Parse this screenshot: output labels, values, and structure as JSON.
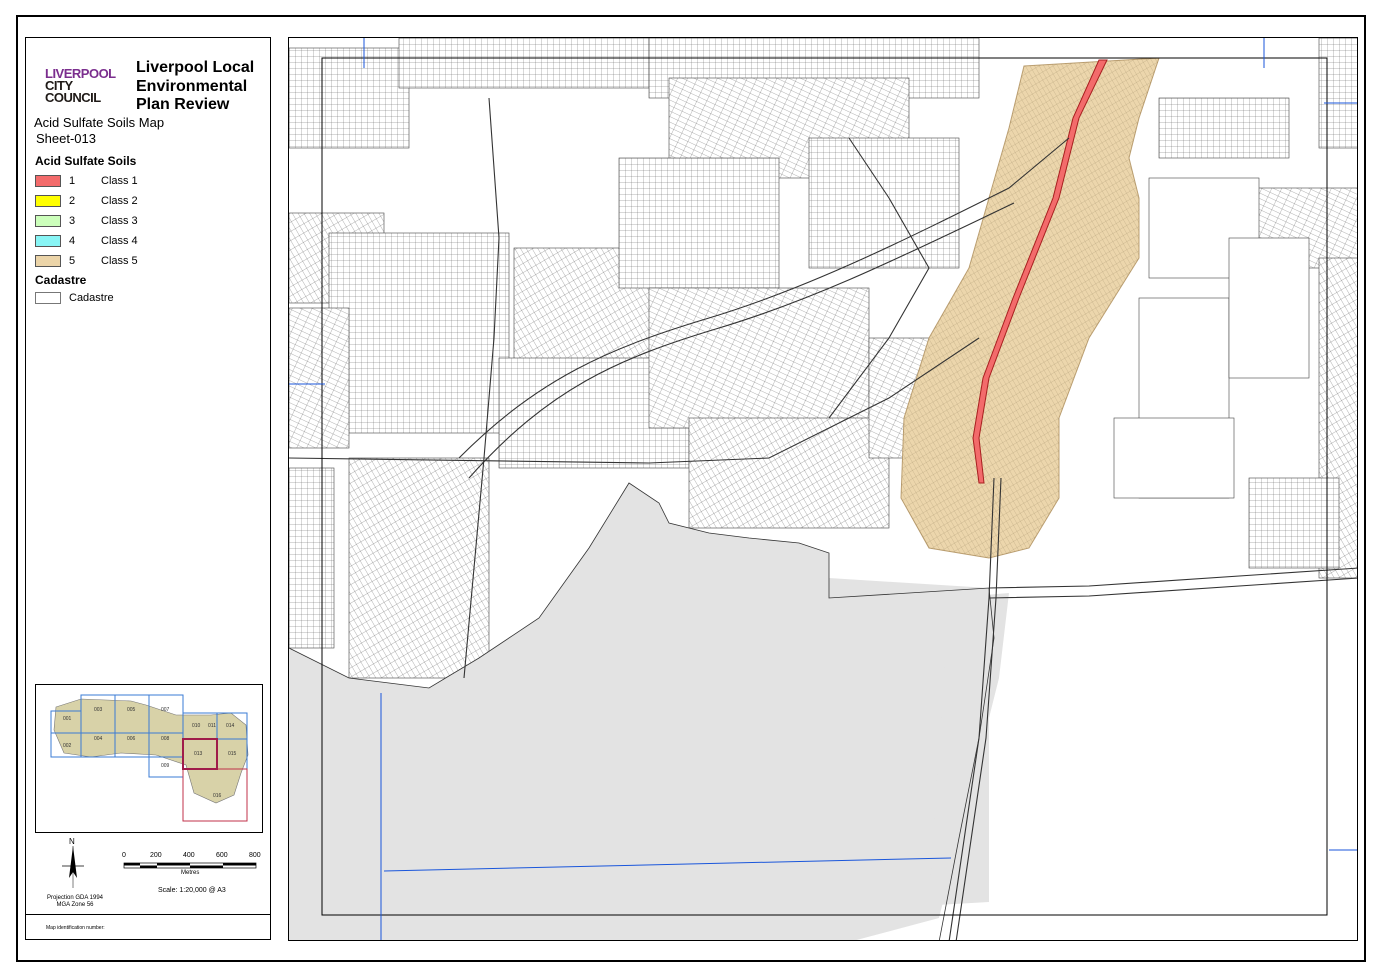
{
  "header": {
    "logo_line1": "LIVERPOOL",
    "logo_line2": "CITY",
    "logo_line3": "COUNCIL",
    "title": "Liverpool Local Environmental Plan Review",
    "subtitle": "Acid Sulfate Soils Map",
    "sheet": "Sheet-013"
  },
  "legend": {
    "heading": "Acid Sulfate Soils",
    "classes": [
      {
        "num": "1",
        "label": "Class 1",
        "color": "#f36b6b"
      },
      {
        "num": "2",
        "label": "Class 2",
        "color": "#ffff00"
      },
      {
        "num": "3",
        "label": "Class 3",
        "color": "#ccffbb"
      },
      {
        "num": "4",
        "label": "Class 4",
        "color": "#88f5f5"
      },
      {
        "num": "5",
        "label": "Class 5",
        "color": "#ebd4a8"
      }
    ],
    "cadastre_heading": "Cadastre",
    "cadastre_label": "Cadastre"
  },
  "keymap": {
    "sheets": [
      "001",
      "002",
      "003",
      "004",
      "005",
      "006",
      "007",
      "008",
      "009",
      "010",
      "011",
      "012",
      "013",
      "014",
      "015",
      "016"
    ],
    "current": "013"
  },
  "north": "N",
  "projection": "Projection GDA 1994 MGA Zone 56",
  "scale": {
    "ticks": [
      "0",
      "200",
      "400",
      "600",
      "800"
    ],
    "unit": "Metres",
    "text": "Scale: 1:20,000 @ A3"
  },
  "footer": {
    "map_id_label": "Map identification number:"
  },
  "colors": {
    "class5_fill": "#ebd4a8",
    "class1_fill": "#f36b6b",
    "grey_area": "#e3e3e3",
    "grid_blue": "#1a56db",
    "logo_purple": "#7b2e8e"
  }
}
